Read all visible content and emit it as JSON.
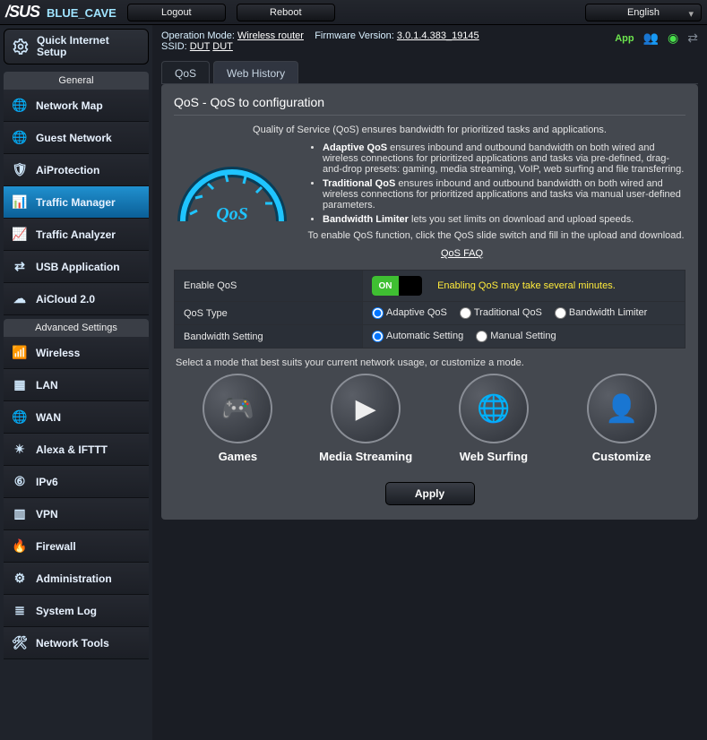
{
  "brand": "/SUS",
  "model": "BLUE_CAVE",
  "top_buttons": {
    "logout": "Logout",
    "reboot": "Reboot"
  },
  "language": "English",
  "info": {
    "op_mode_label": "Operation Mode:",
    "op_mode_value": "Wireless router",
    "fw_label": "Firmware Version:",
    "fw_value": "3.0.1.4.383_19145",
    "ssid_label": "SSID:",
    "ssid_values": [
      "DUT",
      "DUT"
    ],
    "app_label": "App"
  },
  "quick_setup": "Quick Internet Setup",
  "sections": {
    "general": "General",
    "advanced": "Advanced Settings"
  },
  "nav_general": [
    {
      "id": "network-map",
      "label": "Network Map"
    },
    {
      "id": "guest-network",
      "label": "Guest Network"
    },
    {
      "id": "aiprotection",
      "label": "AiProtection"
    },
    {
      "id": "traffic-manager",
      "label": "Traffic Manager",
      "active": true
    },
    {
      "id": "traffic-analyzer",
      "label": "Traffic Analyzer"
    },
    {
      "id": "usb-application",
      "label": "USB Application"
    },
    {
      "id": "aicloud",
      "label": "AiCloud 2.0"
    }
  ],
  "nav_advanced": [
    {
      "id": "wireless",
      "label": "Wireless"
    },
    {
      "id": "lan",
      "label": "LAN"
    },
    {
      "id": "wan",
      "label": "WAN"
    },
    {
      "id": "alexa-ifttt",
      "label": "Alexa & IFTTT"
    },
    {
      "id": "ipv6",
      "label": "IPv6"
    },
    {
      "id": "vpn",
      "label": "VPN"
    },
    {
      "id": "firewall",
      "label": "Firewall"
    },
    {
      "id": "administration",
      "label": "Administration"
    },
    {
      "id": "system-log",
      "label": "System Log"
    },
    {
      "id": "network-tools",
      "label": "Network Tools"
    }
  ],
  "tabs": {
    "qos": "QoS",
    "web_history": "Web History"
  },
  "panel": {
    "title": "QoS - QoS to configuration",
    "intro": "Quality of Service (QoS) ensures bandwidth for prioritized tasks and applications.",
    "bullets": [
      {
        "term": "Adaptive QoS",
        "text": " ensures inbound and outbound bandwidth on both wired and wireless connections for prioritized applications and tasks via pre-defined, drag-and-drop presets: gaming, media streaming, VoIP, web surfing and file transferring."
      },
      {
        "term": "Traditional QoS",
        "text": " ensures inbound and outbound bandwidth on both wired and wireless connections for prioritized applications and tasks via manual user-defined parameters."
      },
      {
        "term": "Bandwidth Limiter",
        "text": " lets you set limits on download and upload speeds."
      }
    ],
    "enable_note": "To enable QoS function, click the QoS slide switch and fill in the upload and download.",
    "faq_link": "QoS FAQ"
  },
  "settings": {
    "enable_label": "Enable QoS",
    "enable_value": "ON",
    "enable_warning": "Enabling QoS may take several minutes.",
    "type_label": "QoS Type",
    "type_options": [
      "Adaptive QoS",
      "Traditional QoS",
      "Bandwidth Limiter"
    ],
    "type_selected": "Adaptive QoS",
    "bw_label": "Bandwidth Setting",
    "bw_options": [
      "Automatic Setting",
      "Manual Setting"
    ],
    "bw_selected": "Automatic Setting"
  },
  "mode_hint": "Select a mode that best suits your current network usage, or customize a mode.",
  "modes": [
    {
      "id": "games",
      "label": "Games"
    },
    {
      "id": "media",
      "label": "Media Streaming"
    },
    {
      "id": "web",
      "label": "Web Surfing"
    },
    {
      "id": "customize",
      "label": "Customize"
    }
  ],
  "apply": "Apply"
}
